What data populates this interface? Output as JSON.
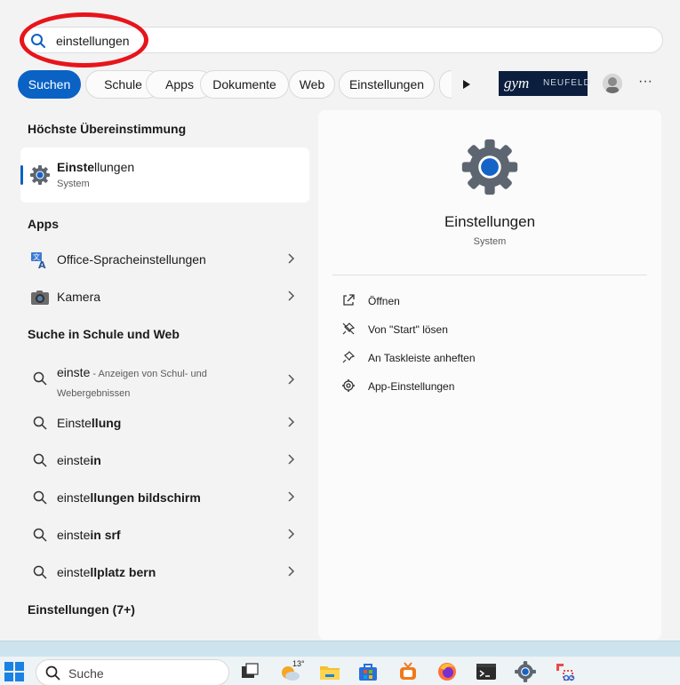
{
  "search": {
    "query": "einstellungen"
  },
  "filters": {
    "chips": [
      "Suchen",
      "Schule",
      "Apps",
      "Dokumente",
      "Web",
      "Einstellungen"
    ],
    "logo_text": {
      "main": "gym",
      "suffix": "NEUFELD"
    }
  },
  "best_match": {
    "heading": "Höchste Übereinstimmung",
    "title_bold": "Einste",
    "title_rest": "llungen",
    "subtitle": "System"
  },
  "apps": {
    "heading": "Apps",
    "items": [
      "Office-Spracheinstellungen",
      "Kamera"
    ]
  },
  "web": {
    "heading": "Suche in Schule und Web",
    "first": {
      "query": "einste",
      "hint_line1": " - Anzeigen von Schul- und",
      "hint_line2": "Webergebnissen"
    },
    "items": [
      {
        "prefix": "Einste",
        "bold": "llung"
      },
      {
        "prefix": "einste",
        "bold": "in"
      },
      {
        "prefix": "einste",
        "bold": "llungen bildschirm"
      },
      {
        "prefix": "einste",
        "bold": "in srf"
      },
      {
        "prefix": "einste",
        "bold": "llplatz bern"
      }
    ]
  },
  "more_settings": {
    "heading": "Einstellungen (7+)"
  },
  "detail": {
    "title": "Einstellungen",
    "subtitle": "System",
    "actions": [
      "Öffnen",
      "Von \"Start\" lösen",
      "An Taskleiste anheften",
      "App-Einstellungen"
    ]
  },
  "taskbar": {
    "search_placeholder": "Suche",
    "weather_temp": "13°"
  },
  "colors": {
    "accent": "#0a62c4",
    "highlight_circle": "#e8141b"
  }
}
